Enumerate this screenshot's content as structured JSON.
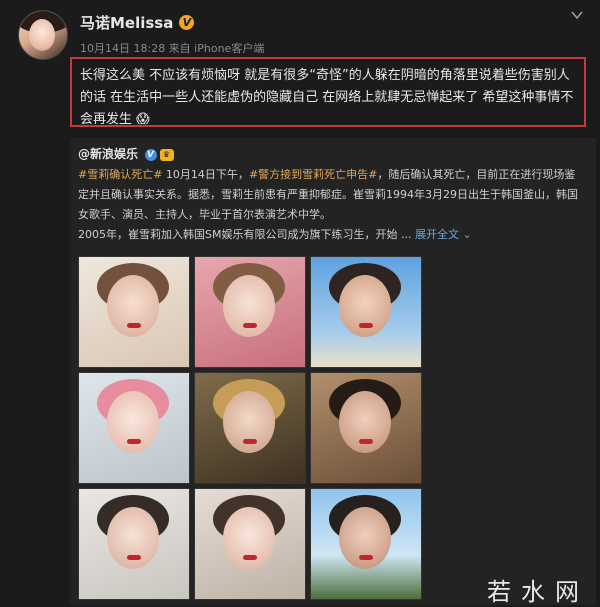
{
  "post": {
    "username": "马诺Melissa",
    "meta": "10月14日 18:28 来自 iPhone客户端",
    "text": "长得这么美 不应该有烦恼呀 就是有很多“奇怪”的人躲在阴暗的角落里说着些伤害别人的话 在生活中一些人还能虚伪的隐藏自己 在网络上就肆无忌惮起来了 希望这种事情不会再发生 😱"
  },
  "repost": {
    "handle": "@新浪娱乐",
    "tag1": "#雪莉确认死亡#",
    "part1": " 10月14日下午，",
    "tag2": "#警方接到雪莉死亡申告#",
    "part2": "，随后确认其死亡，目前正在进行现场鉴定并且确认事实关系。据悉，雪莉生前患有严重抑郁症。崔雪莉1994年3月29日出生于韩国釜山，韩国女歌手、演员、主持人，毕业于首尔表演艺术中学。",
    "part3": "2005年，崔雪莉加入韩国SM娱乐有限公司成为旗下练习生，开始 ...",
    "more": "展开全文 ⌄"
  },
  "watermark": "若水网",
  "colors": {
    "background": "#1b1b1b",
    "highlight_border": "#c33a3a",
    "tag": "#e0a85a",
    "link": "#6aa5de",
    "verified_gold": "#f1a521",
    "verified_blue": "#3d8ee6"
  }
}
